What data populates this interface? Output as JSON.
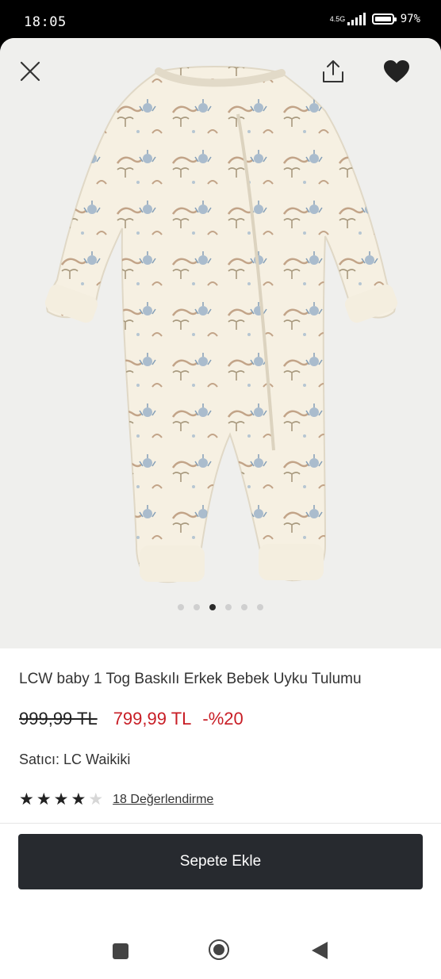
{
  "status_bar": {
    "time": "18:05",
    "network": "4.5G",
    "battery": "97%"
  },
  "gallery": {
    "image_name": "baby-sleep-suit-photo",
    "slide_count": 6,
    "active_slide": 3
  },
  "actions": {
    "close_icon": "close-icon",
    "share_icon": "share-icon",
    "favorite_icon": "heart-filled-icon"
  },
  "product": {
    "title": "LCW baby 1 Tog Baskılı Erkek Bebek Uyku Tulumu",
    "old_price": "999,99 TL",
    "price": "799,99 TL",
    "discount": "-%20",
    "seller": "Satıcı: LC Waikiki",
    "rating": 4,
    "rating_max": 5,
    "reviews": "18 Değerlendirme"
  },
  "cart_button": {
    "label": "Sepete Ekle"
  },
  "colors": {
    "price": "#c81d25",
    "button": "#272a2f"
  }
}
